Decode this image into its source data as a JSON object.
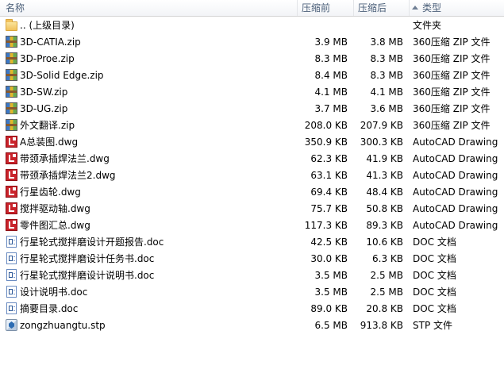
{
  "columns": {
    "name": "名称",
    "packed_size": "压缩前",
    "size": "压缩后",
    "type": "类型"
  },
  "files": [
    {
      "icon": "folder-icon",
      "name": ".. (上级目录)",
      "packed": "",
      "size": "",
      "type": "文件夹"
    },
    {
      "icon": "zip-archive-icon",
      "name": "3D-CATIA.zip",
      "packed": "3.9 MB",
      "size": "3.8 MB",
      "type": "360压缩 ZIP 文件"
    },
    {
      "icon": "zip-archive-icon",
      "name": "3D-Proe.zip",
      "packed": "8.3 MB",
      "size": "8.3 MB",
      "type": "360压缩 ZIP 文件"
    },
    {
      "icon": "zip-archive-icon",
      "name": "3D-Solid Edge.zip",
      "packed": "8.4 MB",
      "size": "8.3 MB",
      "type": "360压缩 ZIP 文件"
    },
    {
      "icon": "zip-archive-icon",
      "name": "3D-SW.zip",
      "packed": "4.1 MB",
      "size": "4.1 MB",
      "type": "360压缩 ZIP 文件"
    },
    {
      "icon": "zip-archive-icon",
      "name": "3D-UG.zip",
      "packed": "3.7 MB",
      "size": "3.6 MB",
      "type": "360压缩 ZIP 文件"
    },
    {
      "icon": "zip-archive-icon",
      "name": "外文翻译.zip",
      "packed": "208.0 KB",
      "size": "207.9 KB",
      "type": "360压缩 ZIP 文件"
    },
    {
      "icon": "dwg-file-icon",
      "name": "A总装图.dwg",
      "packed": "350.9 KB",
      "size": "300.3 KB",
      "type": "AutoCAD Drawing"
    },
    {
      "icon": "dwg-file-icon",
      "name": "带颈承插焊法兰.dwg",
      "packed": "62.3 KB",
      "size": "41.9 KB",
      "type": "AutoCAD Drawing"
    },
    {
      "icon": "dwg-file-icon",
      "name": "带颈承插焊法兰2.dwg",
      "packed": "63.1 KB",
      "size": "41.3 KB",
      "type": "AutoCAD Drawing"
    },
    {
      "icon": "dwg-file-icon",
      "name": "行星齿轮.dwg",
      "packed": "69.4 KB",
      "size": "48.4 KB",
      "type": "AutoCAD Drawing"
    },
    {
      "icon": "dwg-file-icon",
      "name": "搅拌驱动轴.dwg",
      "packed": "75.7 KB",
      "size": "50.8 KB",
      "type": "AutoCAD Drawing"
    },
    {
      "icon": "dwg-file-icon",
      "name": "零件图汇总.dwg",
      "packed": "117.3 KB",
      "size": "89.3 KB",
      "type": "AutoCAD Drawing"
    },
    {
      "icon": "doc-file-icon",
      "name": "行星轮式搅拌磨设计开题报告.doc",
      "packed": "42.5 KB",
      "size": "10.6 KB",
      "type": "DOC 文档"
    },
    {
      "icon": "doc-file-icon",
      "name": "行星轮式搅拌磨设计任务书.doc",
      "packed": "30.0 KB",
      "size": "6.3 KB",
      "type": "DOC 文档"
    },
    {
      "icon": "doc-file-icon",
      "name": "行星轮式搅拌磨设计说明书.doc",
      "packed": "3.5 MB",
      "size": "2.5 MB",
      "type": "DOC 文档"
    },
    {
      "icon": "doc-file-icon",
      "name": "设计说明书.doc",
      "packed": "3.5 MB",
      "size": "2.5 MB",
      "type": "DOC 文档"
    },
    {
      "icon": "doc-file-icon",
      "name": "摘要目录.doc",
      "packed": "89.0 KB",
      "size": "20.8 KB",
      "type": "DOC 文档"
    },
    {
      "icon": "stp-file-icon",
      "name": "zongzhuangtu.stp",
      "packed": "6.5 MB",
      "size": "913.8 KB",
      "type": "STP 文件"
    }
  ]
}
